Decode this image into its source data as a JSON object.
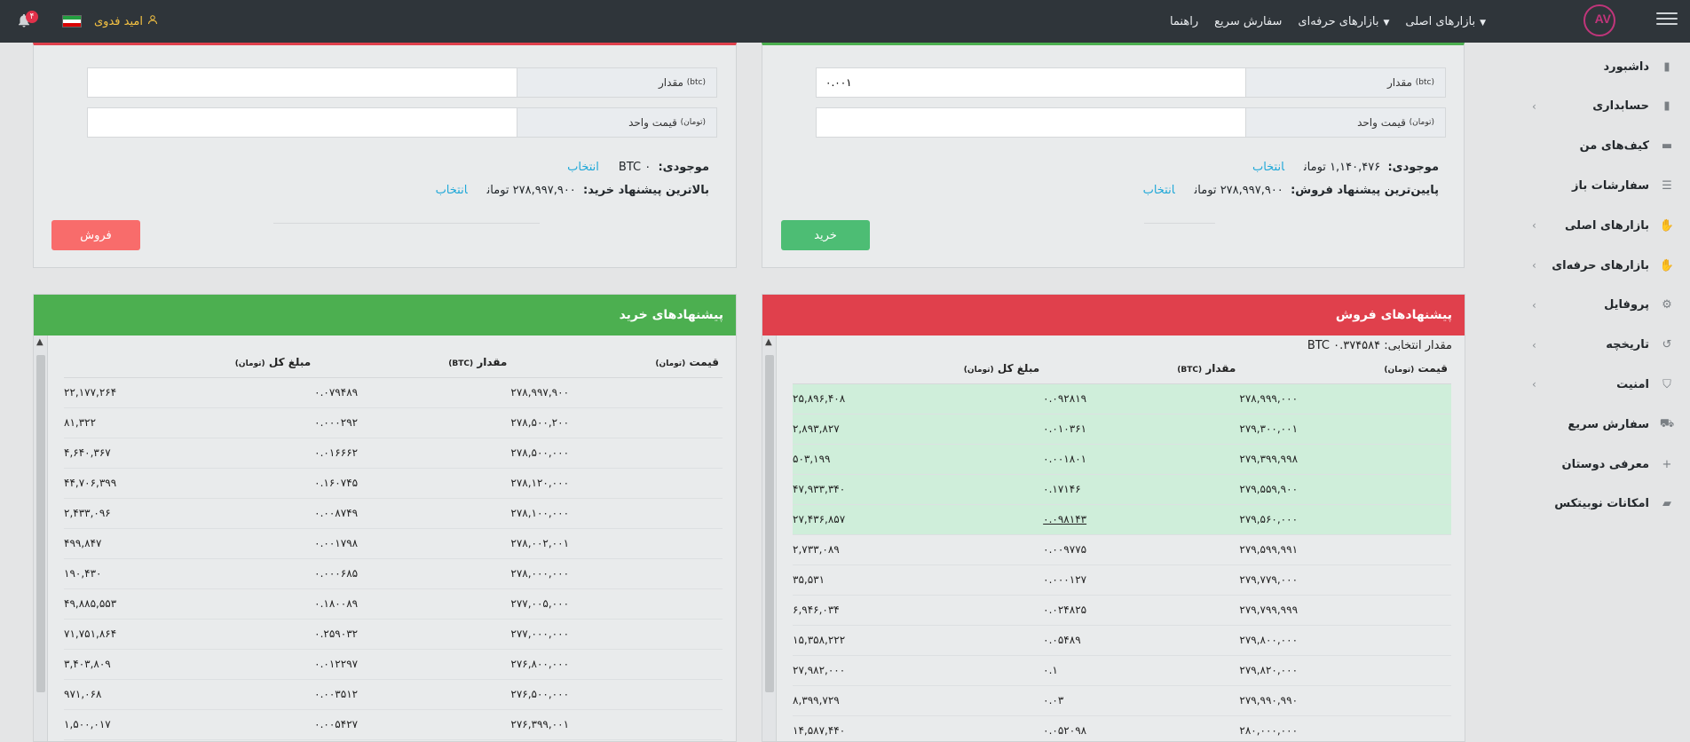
{
  "topbar": {
    "logo_text": "AV",
    "nav": [
      {
        "label": "بازارهای اصلی",
        "dropdown": true
      },
      {
        "label": "بازارهای حرفه‌ای",
        "dropdown": true
      },
      {
        "label": "سفارش سریع",
        "dropdown": false
      },
      {
        "label": "راهنما",
        "dropdown": false
      }
    ],
    "username": "امید فدوی",
    "notification_count": "۴"
  },
  "sidebar": {
    "items": [
      {
        "label": "داشبورد",
        "icon": "clipboard-icon",
        "chevron": false
      },
      {
        "label": "حسابداری",
        "icon": "clipboard-check-icon",
        "chevron": true
      },
      {
        "label": "کیف‌های من",
        "icon": "wallet-icon",
        "chevron": false
      },
      {
        "label": "سفارشات باز",
        "icon": "list-icon",
        "chevron": false
      },
      {
        "label": "بازارهای اصلی",
        "icon": "handshake-icon",
        "chevron": true
      },
      {
        "label": "بازارهای حرفه‌ای",
        "icon": "handshake-icon",
        "chevron": true
      },
      {
        "label": "پروفایل",
        "icon": "user-cog-icon",
        "chevron": true
      },
      {
        "label": "تاریخچه",
        "icon": "history-icon",
        "chevron": true
      },
      {
        "label": "امنیت",
        "icon": "shield-icon",
        "chevron": true
      },
      {
        "label": "سفارش سریع",
        "icon": "truck-icon",
        "chevron": false
      },
      {
        "label": "معرفی دوستان",
        "icon": "user-plus-icon",
        "chevron": false
      },
      {
        "label": "امکانات نوبیتکس",
        "icon": "car-icon",
        "chevron": false
      }
    ]
  },
  "sell_form": {
    "amount_label": "مقدار",
    "amount_unit": "(btc)",
    "amount_value": "",
    "price_label": "قیمت واحد",
    "price_unit": "(تومان)",
    "price_value": "",
    "balance_label": "موجودی:",
    "balance_value": "BTC ۰",
    "select_link": "انتخاب",
    "best_label": "بالاترین پیشنهاد خرید:",
    "best_value": "۲۷۸,۹۹۷,۹۰۰ تومان",
    "button": "فروش"
  },
  "buy_form": {
    "amount_label": "مقدار",
    "amount_unit": "(btc)",
    "amount_value": "۰.۰۰۱",
    "price_label": "قیمت واحد",
    "price_unit": "(تومان)",
    "price_value": "",
    "balance_label": "موجودی:",
    "balance_value": "۱,۱۴۰,۴۷۶ تومان",
    "select_link": "انتخاب",
    "best_label": "پایین‌ترین پیشنهاد فروش:",
    "best_value": "۲۷۸,۹۹۷,۹۰۰ تومان",
    "button": "خرید"
  },
  "buy_offers": {
    "title": "پیشنهادهای خرید",
    "col_price": "قیمت",
    "col_price_unit": "(تومان)",
    "col_amount": "مقدار",
    "col_amount_unit": "(BTC)",
    "col_total": "مبلغ کل",
    "col_total_unit": "(تومان)",
    "rows": [
      [
        "۲۷۸,۹۹۷,۹۰۰",
        "۰.۰۷۹۴۸۹",
        "۲۲,۱۷۷,۲۶۴"
      ],
      [
        "۲۷۸,۵۰۰,۲۰۰",
        "۰.۰۰۰۲۹۲",
        "۸۱,۳۲۲"
      ],
      [
        "۲۷۸,۵۰۰,۰۰۰",
        "۰.۰۱۶۶۶۲",
        "۴,۶۴۰,۳۶۷"
      ],
      [
        "۲۷۸,۱۲۰,۰۰۰",
        "۰.۱۶۰۷۴۵",
        "۴۴,۷۰۶,۳۹۹"
      ],
      [
        "۲۷۸,۱۰۰,۰۰۰",
        "۰.۰۰۸۷۴۹",
        "۲,۴۳۳,۰۹۶"
      ],
      [
        "۲۷۸,۰۰۲,۰۰۱",
        "۰.۰۰۱۷۹۸",
        "۴۹۹,۸۴۷"
      ],
      [
        "۲۷۸,۰۰۰,۰۰۰",
        "۰.۰۰۰۶۸۵",
        "۱۹۰,۴۳۰"
      ],
      [
        "۲۷۷,۰۰۵,۰۰۰",
        "۰.۱۸۰۰۸۹",
        "۴۹,۸۸۵,۵۵۳"
      ],
      [
        "۲۷۷,۰۰۰,۰۰۰",
        "۰.۲۵۹۰۳۲",
        "۷۱,۷۵۱,۸۶۴"
      ],
      [
        "۲۷۶,۸۰۰,۰۰۰",
        "۰.۰۱۲۲۹۷",
        "۳,۴۰۳,۸۰۹"
      ],
      [
        "۲۷۶,۵۰۰,۰۰۰",
        "۰.۰۰۳۵۱۲",
        "۹۷۱,۰۶۸"
      ],
      [
        "۲۷۶,۳۹۹,۰۰۱",
        "۰.۰۰۵۴۲۷",
        "۱,۵۰۰,۰۱۷"
      ]
    ]
  },
  "sell_offers": {
    "title": "پیشنهادهای فروش",
    "selected_amount": "مقدار انتخابی: BTC ۰.۳۷۴۵۸۴",
    "col_price": "قیمت",
    "col_price_unit": "(تومان)",
    "col_amount": "مقدار",
    "col_amount_unit": "(BTC)",
    "col_total": "مبلغ کل",
    "col_total_unit": "(تومان)",
    "highlighted_rows": 5,
    "rows": [
      [
        "۲۷۸,۹۹۹,۰۰۰",
        "۰.۰۹۲۸۱۹",
        "۲۵,۸۹۶,۴۰۸"
      ],
      [
        "۲۷۹,۳۰۰,۰۰۱",
        "۰.۰۱۰۳۶۱",
        "۲,۸۹۳,۸۲۷"
      ],
      [
        "۲۷۹,۳۹۹,۹۹۸",
        "۰.۰۰۱۸۰۱",
        "۵۰۳,۱۹۹"
      ],
      [
        "۲۷۹,۵۵۹,۹۰۰",
        "۰.۱۷۱۴۶",
        "۴۷,۹۳۳,۳۴۰"
      ],
      [
        "۲۷۹,۵۶۰,۰۰۰",
        "۰.۰۹۸۱۴۳",
        "۲۷,۴۳۶,۸۵۷"
      ],
      [
        "۲۷۹,۵۹۹,۹۹۱",
        "۰.۰۰۹۷۷۵",
        "۲,۷۳۳,۰۸۹"
      ],
      [
        "۲۷۹,۷۷۹,۰۰۰",
        "۰.۰۰۰۱۲۷",
        "۳۵,۵۳۱"
      ],
      [
        "۲۷۹,۷۹۹,۹۹۹",
        "۰.۰۲۴۸۲۵",
        "۶,۹۴۶,۰۳۴"
      ],
      [
        "۲۷۹,۸۰۰,۰۰۰",
        "۰.۰۵۴۸۹",
        "۱۵,۳۵۸,۲۲۲"
      ],
      [
        "۲۷۹,۸۲۰,۰۰۰",
        "۰.۱",
        "۲۷,۹۸۲,۰۰۰"
      ],
      [
        "۲۷۹,۹۹۰,۹۹۰",
        "۰.۰۳",
        "۸,۳۹۹,۷۲۹"
      ],
      [
        "۲۸۰,۰۰۰,۰۰۰",
        "۰.۰۵۲۰۹۸",
        "۱۴,۵۸۷,۴۴۰"
      ]
    ]
  },
  "colors": {
    "topbar": "#2f353a",
    "sell_red": "#e0404c",
    "buy_green": "#4caf50",
    "highlight": "#cfeeda",
    "link": "#20a8d8",
    "username": "#f5c242"
  }
}
